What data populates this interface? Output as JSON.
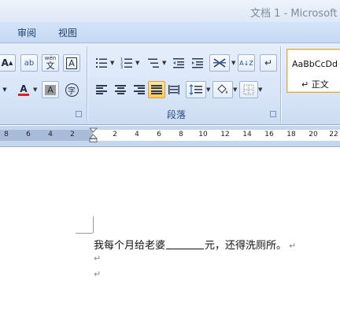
{
  "window": {
    "title": "文档 1 - Microsoft"
  },
  "tabs": [
    {
      "label": "审阅"
    },
    {
      "label": "视图"
    }
  ],
  "ribbon": {
    "font_group": {
      "grow_font": "A",
      "clear_format": "ab",
      "phonetic_top": "wén",
      "phonetic_bottom": "文",
      "char_border": "A",
      "font_color": "A",
      "char_shading": "A",
      "enclose_char": "字",
      "font_color_hex": "#e02020"
    },
    "paragraph_group": {
      "label": "段落",
      "sort": "A↓Z",
      "show_marks": "↵"
    },
    "styles_group": {
      "sample": "AaBbCcDd",
      "style_name": "↵ 正文"
    }
  },
  "ruler": {
    "left_numbers": [
      "8",
      "6",
      "4",
      "2"
    ],
    "right_numbers": [
      "2",
      "4",
      "6",
      "8",
      "10",
      "12",
      "14",
      "16",
      "18",
      "20",
      "22"
    ]
  },
  "document": {
    "line1_before": "我每个月给老婆",
    "line1_after": "元，还得洗厕所。",
    "paragraph_mark": "↵"
  }
}
